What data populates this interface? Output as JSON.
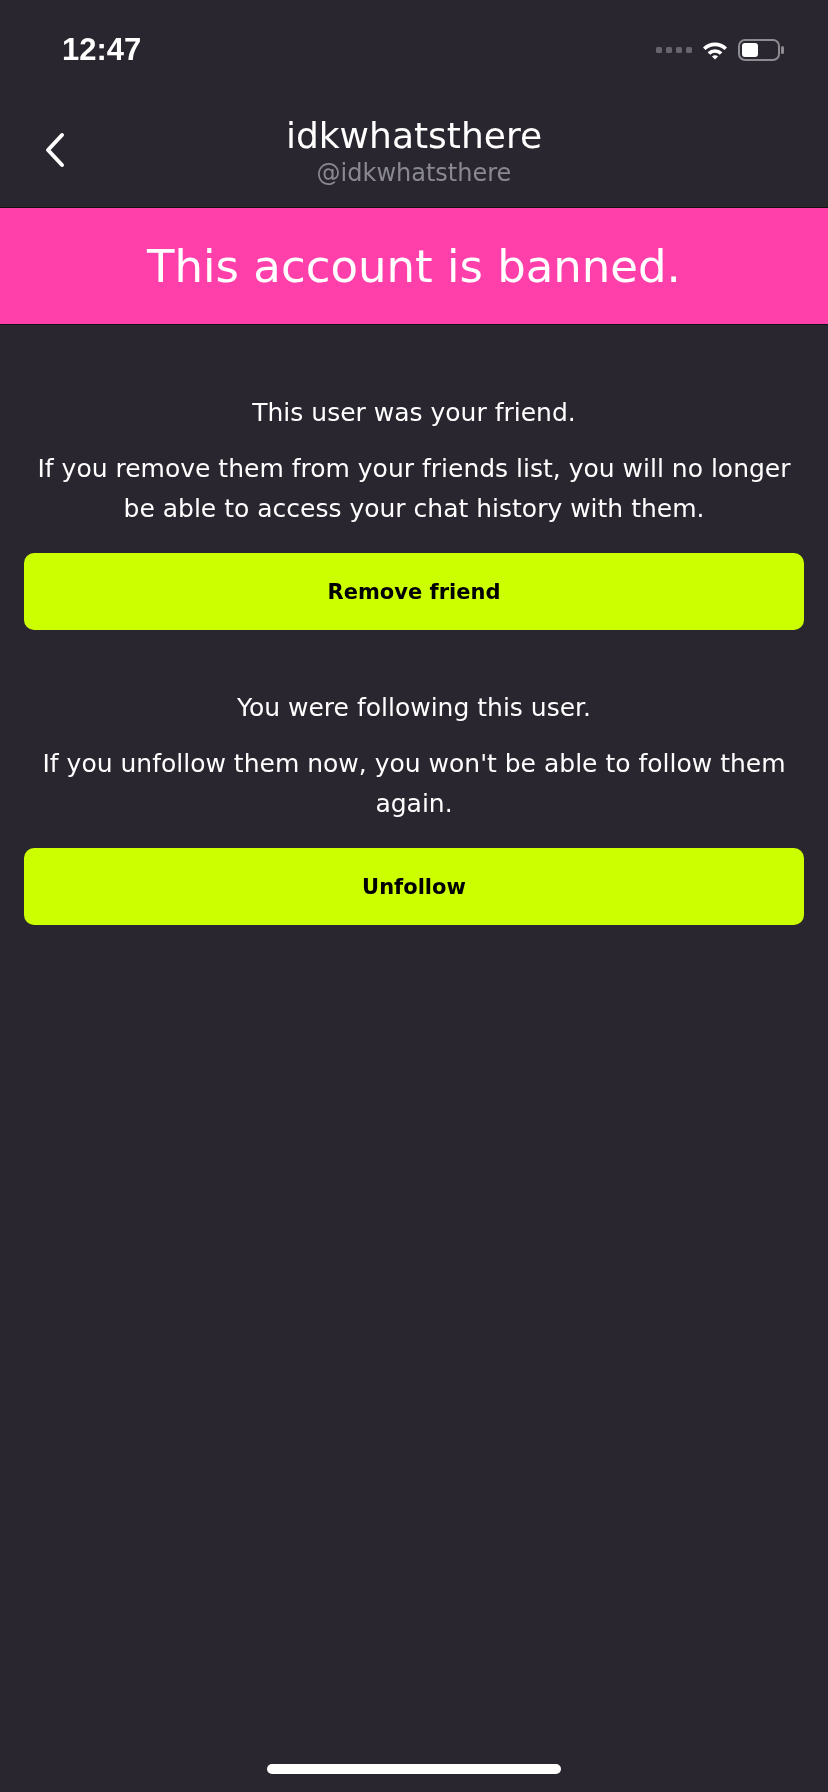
{
  "status_bar": {
    "time": "12:47"
  },
  "header": {
    "title": "idkwhatsthere",
    "handle": "@idkwhatsthere"
  },
  "banner": {
    "text": "This account is banned."
  },
  "sections": [
    {
      "heading": "This user was your friend.",
      "body": "If you remove them from your friends list, you will no longer be able to access your chat history with them.",
      "button": "Remove friend"
    },
    {
      "heading": "You were following this user.",
      "body": "If you unfollow them now, you won't be able to follow them again.",
      "button": "Unfollow"
    }
  ]
}
